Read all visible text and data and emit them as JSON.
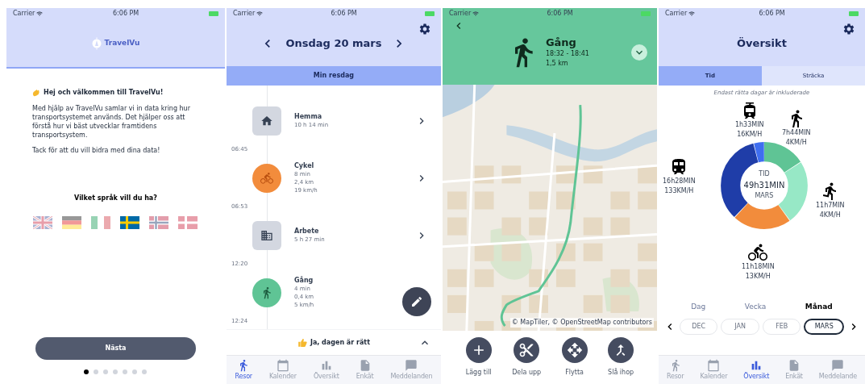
{
  "welcome_screen": {
    "status_bar": {
      "carrier": "Carrier",
      "time": "6:06 PM"
    },
    "logo_text": "TravelVu",
    "greeting": "Hej och välkommen till TravelVu!",
    "paragraphs": [
      "Med hjälp av TravelVu samlar vi in data kring hur transportsystemet används. Det hjälper oss att förstå hur vi bäst utvecklar framtidens transportsystem.",
      "Tack för att du vill bidra med dina data!"
    ],
    "language_question": "Vilket språk vill du ha?",
    "languages": [
      {
        "kind": "uk",
        "selected": false
      },
      {
        "kind": "de",
        "selected": false
      },
      {
        "kind": "it",
        "selected": false
      },
      {
        "kind": "se",
        "selected": true
      },
      {
        "kind": "no",
        "selected": false
      },
      {
        "kind": "dk",
        "selected": false
      }
    ],
    "next_button": "Nästa",
    "page_dots": [
      {
        "selected": true
      },
      {
        "selected": false
      },
      {
        "selected": false
      },
      {
        "selected": false
      },
      {
        "selected": false
      },
      {
        "selected": false
      },
      {
        "selected": false
      }
    ]
  },
  "day_screen": {
    "status_bar": {
      "carrier": "Carrier",
      "time": "6:06 PM"
    },
    "date": "Onsdag 20 mars",
    "section_title": "Min resdag",
    "timeline": [
      {
        "kind": "home",
        "name": "Hemma",
        "details": [
          "10 h 14 min"
        ]
      },
      {
        "kind": "time",
        "text": "06:45"
      },
      {
        "kind": "bike",
        "name": "Cykel",
        "details": [
          "8 min",
          "2,4 km",
          "19 km/h"
        ]
      },
      {
        "kind": "time",
        "text": "06:53"
      },
      {
        "kind": "work",
        "name": "Arbete",
        "details": [
          "5 h 27 min"
        ]
      },
      {
        "kind": "time",
        "text": "12:20"
      },
      {
        "kind": "walk",
        "name": "Gång",
        "details": [
          "4 min",
          "0,4 km",
          "5 km/h"
        ]
      },
      {
        "kind": "time",
        "text": "12:24"
      }
    ],
    "confirm_text": "Ja, dagen är rätt",
    "tab_bar": [
      {
        "kind": "walk",
        "label": "Resor",
        "selected": true
      },
      {
        "kind": "calendar",
        "label": "Kalender",
        "selected": false
      },
      {
        "kind": "chart",
        "label": "Översikt",
        "selected": false
      },
      {
        "kind": "survey",
        "label": "Enkät",
        "selected": false
      },
      {
        "kind": "messages",
        "label": "Meddelanden",
        "selected": false
      }
    ]
  },
  "trip_screen": {
    "status_bar": {
      "carrier": "Carrier",
      "time": "6:06 PM"
    },
    "title": "Gång",
    "time_range": "18:32 - 18:41",
    "distance": "1,5 km",
    "attribution": "© MapTiler, © OpenStreetMap contributors",
    "actions": [
      {
        "kind": "add",
        "label": "Lägg till"
      },
      {
        "kind": "split",
        "label": "Dela upp"
      },
      {
        "kind": "move",
        "label": "Flytta"
      },
      {
        "kind": "merge",
        "label": "Slå ihop"
      }
    ]
  },
  "overview_screen": {
    "status_bar": {
      "carrier": "Carrier",
      "time": "6:06 PM"
    },
    "title": "Översikt",
    "tabs": [
      {
        "label": "Tid",
        "selected": true
      },
      {
        "label": "Sträcka",
        "selected": false
      }
    ],
    "note": "Endast rätta dagar är inkluderade",
    "modes": [
      {
        "kind": "tram",
        "time": "1h33MIN",
        "speed": "16KM/H"
      },
      {
        "kind": "walk",
        "time": "7h44MIN",
        "speed": "4KM/H"
      },
      {
        "kind": "train",
        "time": "16h28MIN",
        "speed": "133KM/H"
      },
      {
        "kind": "run",
        "time": "11h7MIN",
        "speed": "4KM/H"
      },
      {
        "kind": "bike",
        "time": "11h18MIN",
        "speed": "13KM/H"
      }
    ],
    "center": {
      "label": "TID",
      "total": "49h31MIN",
      "period": "MARS"
    },
    "periods": [
      {
        "label": "Dag",
        "selected": false
      },
      {
        "label": "Vecka",
        "selected": false
      },
      {
        "label": "Månad",
        "selected": true
      }
    ],
    "months": [
      {
        "label": "DEC",
        "selected": false
      },
      {
        "label": "JAN",
        "selected": false
      },
      {
        "label": "FEB",
        "selected": false
      },
      {
        "label": "MARS",
        "selected": true
      }
    ],
    "tab_bar": [
      {
        "kind": "walk",
        "label": "Resor",
        "selected": false
      },
      {
        "kind": "calendar",
        "label": "Kalender",
        "selected": false
      },
      {
        "kind": "chart",
        "label": "Översikt",
        "selected": true
      },
      {
        "kind": "survey",
        "label": "Enkät",
        "selected": false
      },
      {
        "kind": "messages",
        "label": "Meddelande",
        "selected": false
      }
    ]
  }
}
